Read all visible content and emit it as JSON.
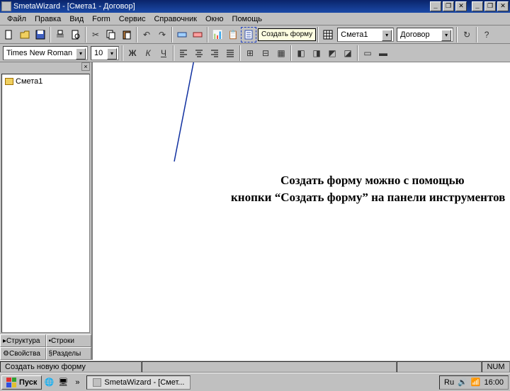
{
  "title": "SmetaWizard - [Смета1 - Договор]",
  "window_controls": {
    "min": "_",
    "max": "❐",
    "close": "✕",
    "doc_max": "❐",
    "doc_close": "✕"
  },
  "menu": [
    "Файл",
    "Правка",
    "Вид",
    "Form",
    "Сервис",
    "Справочник",
    "Окно",
    "Помощь"
  ],
  "toolbar1": {
    "selectors": {
      "smeta": "Смета1",
      "form": "Договор"
    }
  },
  "toolbar2": {
    "font": "Times New Roman",
    "size": "10",
    "bold": "Ж",
    "italic": "К",
    "underline": "Ч"
  },
  "tooltip_create_form": "Создать форму",
  "sidepanel": {
    "tree_root": "Смета1",
    "tabs": [
      "Структура",
      "Строки",
      "Свойства",
      "Разделы"
    ]
  },
  "callout": {
    "line1": "Создать форму можно с помощью",
    "line2": "кнопки “Создать форму” на панели инструментов"
  },
  "statusbar": {
    "hint": "Создать новую форму",
    "num": "NUM"
  },
  "taskbar": {
    "start": "Пуск",
    "app": "SmetaWizard - [Смет...",
    "clock": "16:00",
    "lang": "Ru"
  }
}
